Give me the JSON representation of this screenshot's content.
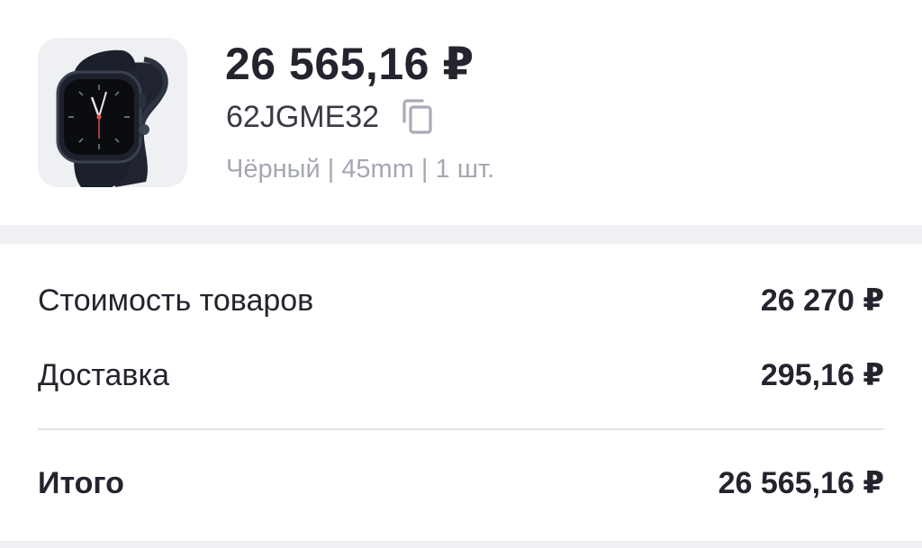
{
  "product": {
    "price": "26 565,16 ₽",
    "sku": "62JGME32",
    "attributes": "Чёрный | 45mm | 1 шт.",
    "image_icon": "smartwatch-icon",
    "copy_icon": "copy-icon"
  },
  "summary": {
    "goods_label": "Стоимость товаров",
    "goods_value": "26 270 ₽",
    "delivery_label": "Доставка",
    "delivery_value": "295,16 ₽",
    "total_label": "Итого",
    "total_value": "26 565,16 ₽"
  },
  "colors": {
    "text": "#24242e",
    "muted": "#a5a7b3",
    "band": "#eef0f3",
    "thumb_bg": "#eef0f4",
    "icon": "#a9abb6"
  }
}
